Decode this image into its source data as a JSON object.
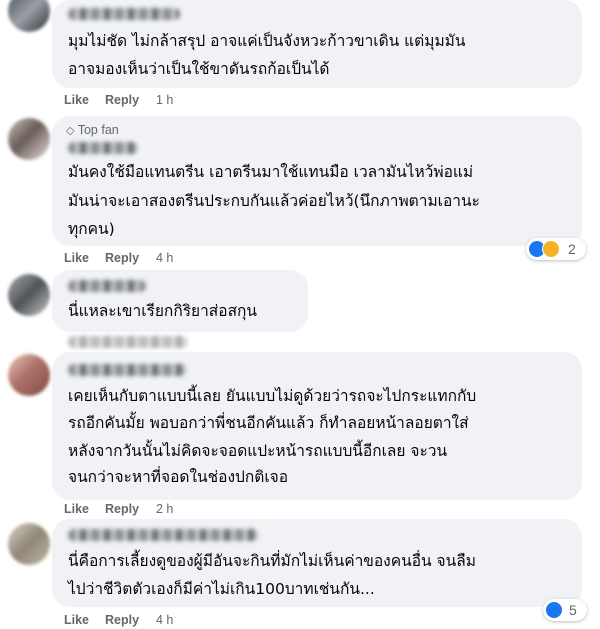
{
  "comments": [
    {
      "text_lines": [
        "มุมไม่ชัด ไม่กล้าสรุป อาจแค่เป็นจังหวะก้าวขาเดิน แต่มุมมัน",
        "อาจมองเห็นว่าเป็นใช้ขาดันรถก้อเป็นได้"
      ],
      "like": "Like",
      "reply": "Reply",
      "time": "1 h"
    },
    {
      "badge": "Top fan",
      "text_lines": [
        "มันคงใช้มือแทนตรีน เอาตรีนมาใช้แทนมือ เวลามันไหว้พ่อแม่",
        "มันน่าจะเอาสองตรีนประกบกันแล้วค่อยไหว้(นึกภาพตามเอานะ",
        "ทุกคน)"
      ],
      "like": "Like",
      "reply": "Reply",
      "time": "4 h",
      "reaction_count": "2"
    },
    {
      "text_lines": [
        "นี่แหละเขาเรียกกิริยาส่อสกุน"
      ]
    },
    {
      "text_lines": [
        "เคยเห็นกับตาแบบนี้เลย ยันแบบไม่ดูด้วยว่ารถจะไปกระแทกกับ",
        "รถอีกคันมั้ย พอบอกว่าพี่ชนอีกคันแล้ว ก็ทำลอยหน้าลอยตาใส่",
        "หลังจากวันนั้นไม่คิดจะจอดแปะหน้ารถแบบนี้อีกเลย จะวน",
        "จนกว่าจะหาที่จอดในช่องปกติเจอ"
      ],
      "like": "Like",
      "reply": "Reply",
      "time": "2 h"
    },
    {
      "text_lines": [
        "นี่คือการเลี้ยงดูของผู้มีอันจะกินที่มักไม่เห็นค่าของคนอื่น จนลืม",
        "ไปว่าชีวิตตัวเองก็มีค่าไม่เกิน100บาทเช่นกัน..."
      ],
      "like": "Like",
      "reply": "Reply",
      "time": "4 h",
      "reaction_count": "5"
    }
  ],
  "colors": {
    "like_blue": "#1877f2",
    "haha_yellow": "#f7b125",
    "bubble": "#f0f2f5",
    "meta_gray": "#65676b"
  }
}
